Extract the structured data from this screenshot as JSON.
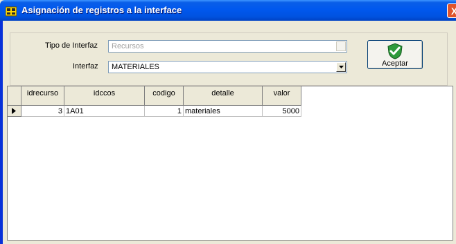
{
  "window": {
    "title": "Asignación de registros a la interface",
    "close_symbol": "X",
    "icon": "app-grid-icon"
  },
  "form": {
    "tipo_label": "Tipo de Interfaz",
    "tipo_value": "Recursos",
    "interfaz_label": "Interfaz",
    "interfaz_value": "MATERIALES",
    "accept_label": "Aceptar",
    "accept_icon": "shield-check-icon"
  },
  "grid": {
    "columns": [
      "idrecurso",
      "idccos",
      "codigo",
      "detalle",
      "valor"
    ],
    "rows": [
      {
        "idrecurso": "3",
        "idccos": "1A01",
        "codigo": "1",
        "detalle": "materiales",
        "valor": "5000"
      }
    ]
  },
  "colors": {
    "titlebar": "#0058ee",
    "window_bg": "#ece9d8",
    "close": "#e0542c",
    "shield": "#2e9a3c"
  }
}
